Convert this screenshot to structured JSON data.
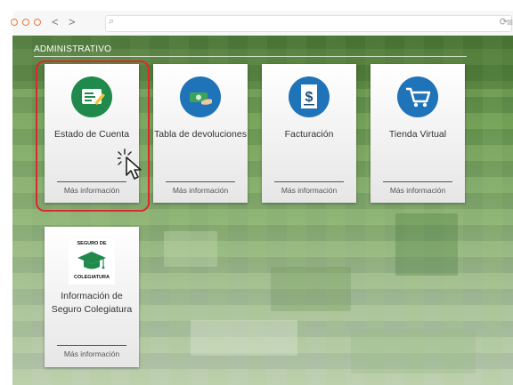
{
  "browser": {
    "nav_back": "<",
    "nav_forward": ">",
    "search_glyph": "⌕",
    "reload_glyph": "⟳",
    "menu_glyph": "≡"
  },
  "section": {
    "title": "ADMINISTRATIVO"
  },
  "cards": [
    {
      "label": "Estado de Cuenta",
      "more": "Más información",
      "icon": "statement-icon",
      "color": "#1f8a4c"
    },
    {
      "label": "Tabla de devoluciones",
      "more": "Más información",
      "icon": "money-hand-icon",
      "color": "#1f73b8"
    },
    {
      "label": "Facturación",
      "more": "Más información",
      "icon": "invoice-icon",
      "color": "#1f73b8"
    },
    {
      "label": "Tienda Virtual",
      "more": "Más información",
      "icon": "shopping-cart-icon",
      "color": "#1f73b8"
    },
    {
      "label": "Información de Seguro Colegiatura",
      "more": "Más información",
      "icon": "tuition-insurance-logo",
      "logo_top": "SEGURO DE",
      "logo_bottom": "COLEGIATURA"
    }
  ],
  "colors": {
    "highlight": "#e0262a",
    "window_dot": "#e87b3c"
  }
}
